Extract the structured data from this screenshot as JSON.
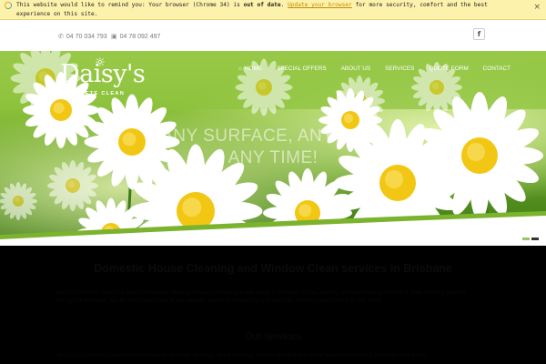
{
  "notice": {
    "text_before": "This website would like to remind you: Your browser (Chrome 34) is ",
    "bold": "out of date",
    "text_mid": ". ",
    "link": "Update your browser",
    "text_after": " for more security, comfort and the best experience on this site.",
    "close": "×"
  },
  "topbar": {
    "phone1": "04 70 034 793",
    "phone2": "04 78 092 497",
    "facebook": "f"
  },
  "logo": {
    "word": "Daisy's",
    "sub": "COMPLETE CLEAN"
  },
  "nav": {
    "items": [
      {
        "label": "Home",
        "icon": "home-icon"
      },
      {
        "label": "Special Offers"
      },
      {
        "label": "About Us"
      },
      {
        "label": "Services"
      },
      {
        "label": "Quote Form"
      },
      {
        "label": "Contact"
      }
    ]
  },
  "hero": {
    "headline_line1": "ANY SURFACE, ANY SIZE,",
    "headline_line2": "ANY TIME!"
  },
  "content": {
    "heading": "Domestic House Cleaning and Window Clean services in Brisbane",
    "paragraph": "Daisy's Complete Clean is a local professional cleaning company providing a wide range of domestic house cleaning, window cleaning and end of lease cleaning services throughout Brisbane. We are fully insured and all our cleaners are police checked so you can relax knowing your home is in safe hands.",
    "subheading": "Our services",
    "paragraph2": "At Daisy's Complete Clean we provide regular domestic cleaning, spring cleaning, window cleaning and end of lease bond cleaning for homes and offices."
  },
  "colors": {
    "notice_bg": "#fdf2ab",
    "hero_green": "#8bbf3a",
    "daisy_center": "#f2c714"
  }
}
